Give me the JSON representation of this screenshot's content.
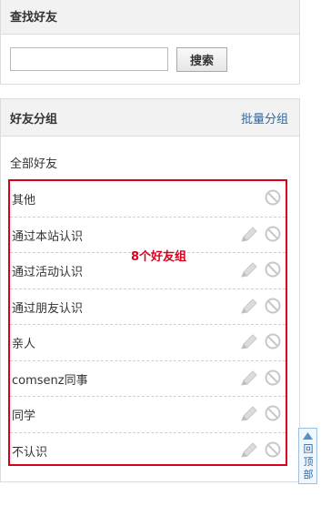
{
  "search": {
    "title": "查找好友",
    "input_value": "",
    "input_placeholder": "",
    "button_label": "搜索"
  },
  "groups": {
    "title": "好友分组",
    "batch_action": "批量分组",
    "all_friends": "全部好友",
    "annotation": "8个好友组",
    "items": [
      {
        "label": "其他",
        "editable": false
      },
      {
        "label": "通过本站认识",
        "editable": true
      },
      {
        "label": "通过活动认识",
        "editable": true
      },
      {
        "label": "通过朋友认识",
        "editable": true
      },
      {
        "label": "亲人",
        "editable": true
      },
      {
        "label": "comsenz同事",
        "editable": true
      },
      {
        "label": "同学",
        "editable": true
      },
      {
        "label": "不认识",
        "editable": true
      }
    ]
  },
  "back_to_top": {
    "label": "回顶部"
  },
  "colors": {
    "annotation_red": "#d9001b",
    "link_blue": "#336699",
    "header_bg": "#f2f2f2"
  },
  "icons": {
    "edit": "pencil-icon",
    "delete": "disabled-circle-icon",
    "back_to_top": "up-arrow-icon"
  }
}
